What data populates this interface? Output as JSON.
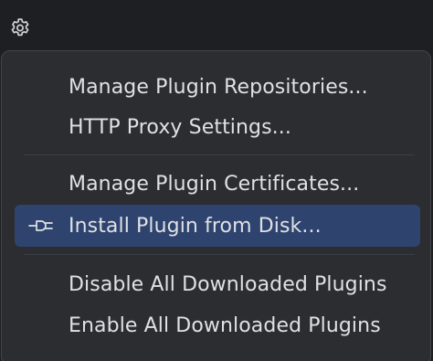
{
  "toolbar": {
    "settings_icon": "gear-icon"
  },
  "menu": {
    "items": [
      {
        "label": "Manage Plugin Repositories..."
      },
      {
        "label": "HTTP Proxy Settings..."
      },
      {
        "label": "Manage Plugin Certificates..."
      },
      {
        "label": "Install Plugin from Disk...",
        "icon": "plug-icon",
        "selected": true
      },
      {
        "label": "Disable All Downloaded Plugins"
      },
      {
        "label": "Enable All Downloaded Plugins"
      }
    ]
  },
  "colors": {
    "background": "#1e1f22",
    "menu_background": "#2b2d30",
    "menu_border": "#43454a",
    "selection": "#2e436e",
    "text": "#dfe1e5",
    "separator": "#3c3f44"
  }
}
